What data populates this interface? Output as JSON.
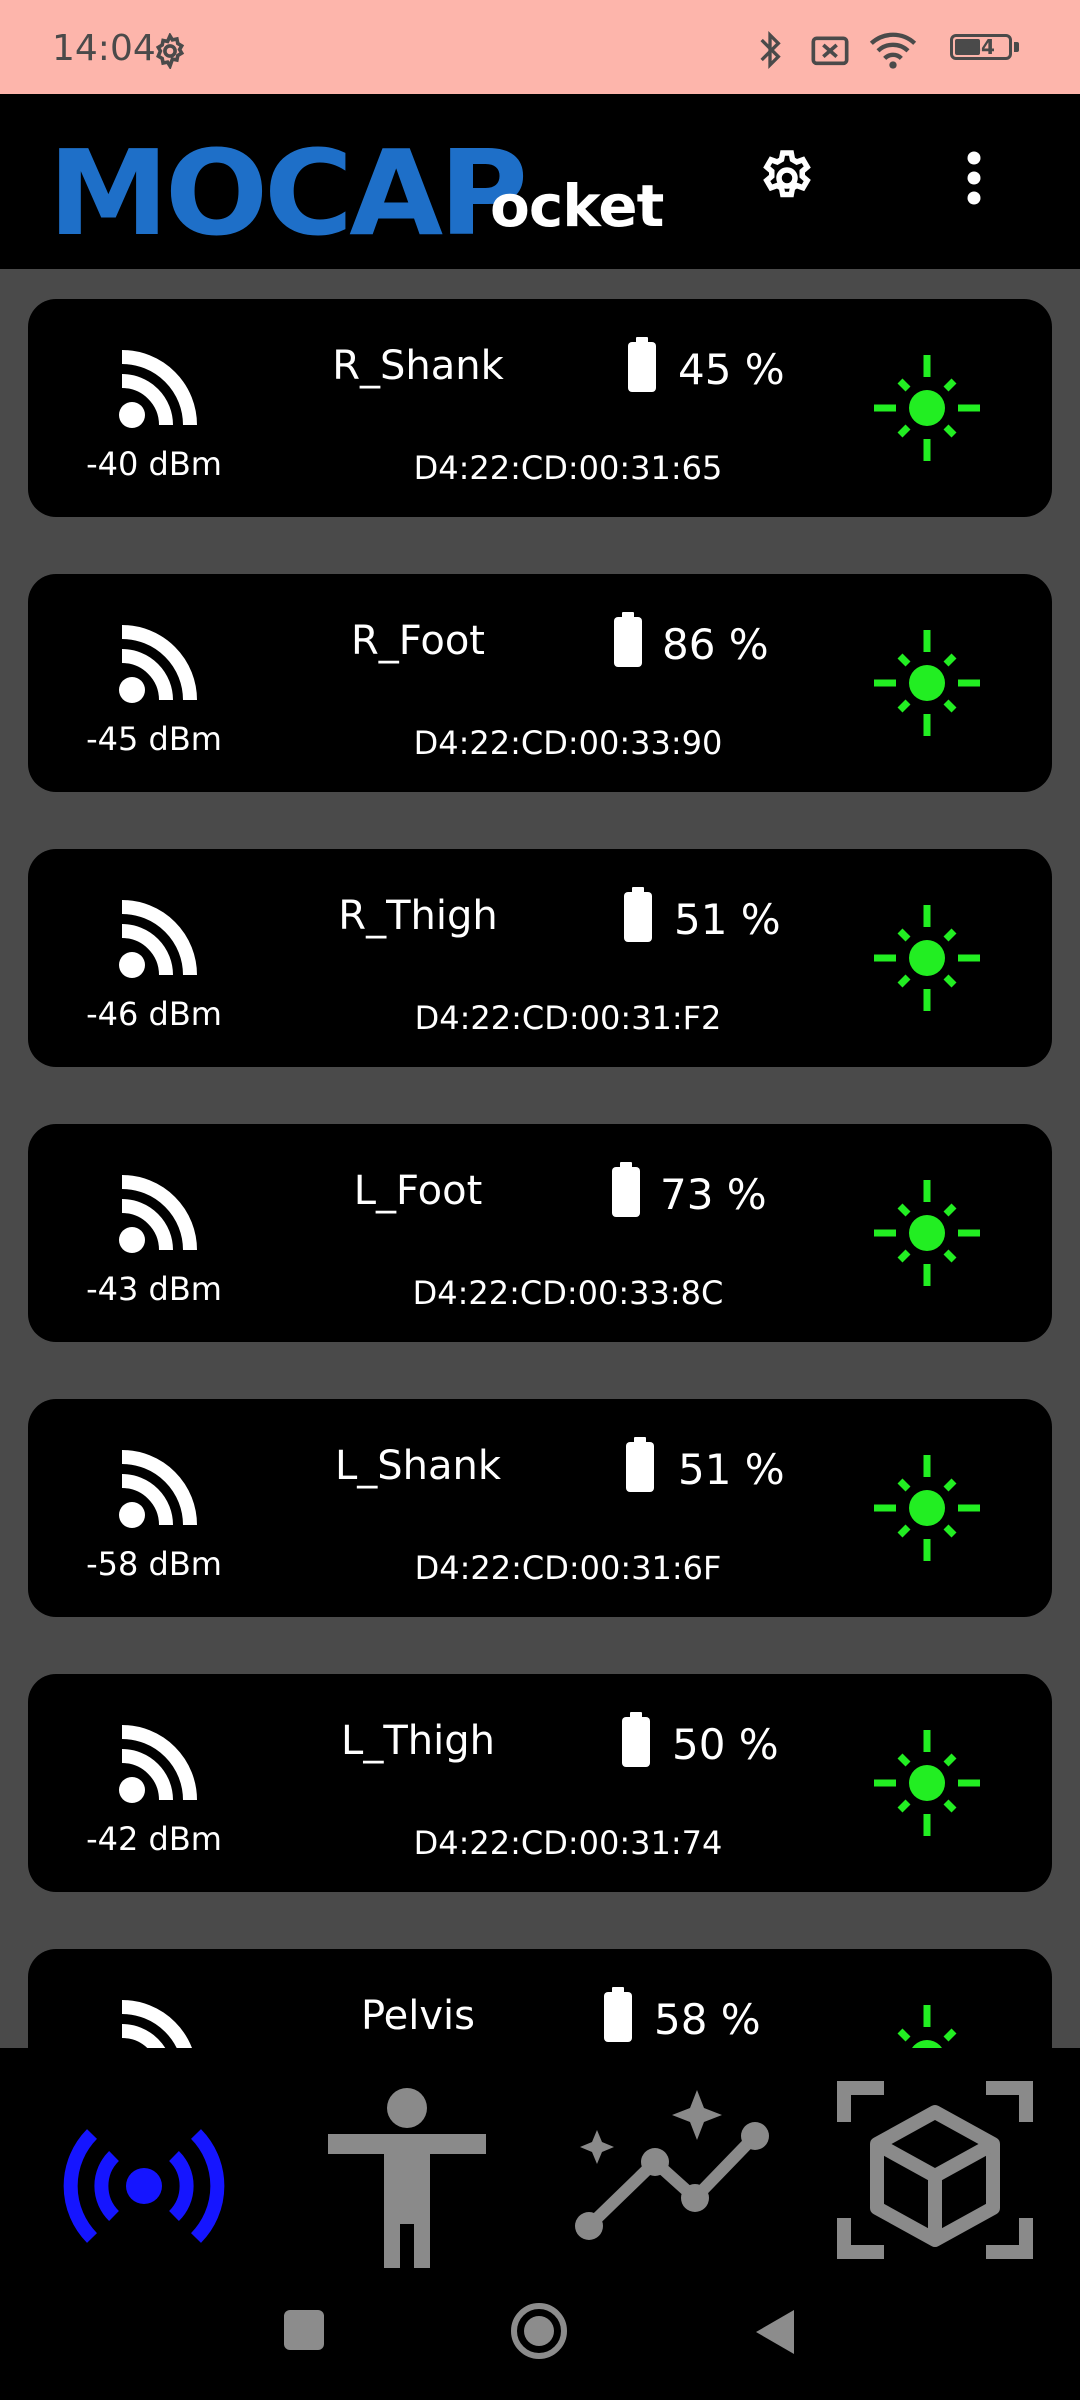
{
  "status_bar": {
    "time": "14:04",
    "battery_level": "44",
    "icons": [
      "settings-gear-icon",
      "bluetooth-icon",
      "screen-record-icon",
      "wifi-icon",
      "battery-icon"
    ]
  },
  "app_bar": {
    "logo_main": "MOCAP",
    "logo_suffix": "ocket",
    "icons": [
      "settings-icon",
      "more-vert-icon"
    ]
  },
  "colors": {
    "status_bar_bg": "#fdb5ab",
    "logo_blue": "#1e6fc8",
    "content_bg": "#4a4a4a",
    "card_bg": "#000000",
    "locate_green": "#22ee22",
    "nav_active_blue": "#1515ff",
    "nav_inactive_gray": "#8a8a8a"
  },
  "sensors": [
    {
      "rssi": "-40 dBm",
      "name": "R_Shank",
      "battery": "45 %",
      "mac": "D4:22:CD:00:31:65"
    },
    {
      "rssi": "-45 dBm",
      "name": "R_Foot",
      "battery": "86 %",
      "mac": "D4:22:CD:00:33:90"
    },
    {
      "rssi": "-46 dBm",
      "name": "R_Thigh",
      "battery": "51 %",
      "mac": "D4:22:CD:00:31:F2"
    },
    {
      "rssi": "-43 dBm",
      "name": "L_Foot",
      "battery": "73 %",
      "mac": "D4:22:CD:00:33:8C"
    },
    {
      "rssi": "-58 dBm",
      "name": "L_Shank",
      "battery": "51 %",
      "mac": "D4:22:CD:00:31:6F"
    },
    {
      "rssi": "-42 dBm",
      "name": "L_Thigh",
      "battery": "50 %",
      "mac": "D4:22:CD:00:31:74"
    },
    {
      "rssi": "",
      "name": "Pelvis",
      "battery": "58 %",
      "mac": ""
    }
  ],
  "bottom_nav": [
    {
      "icon": "sensors-broadcast-icon",
      "active": true
    },
    {
      "icon": "body-pose-icon",
      "active": false
    },
    {
      "icon": "analytics-sparkle-icon",
      "active": false
    },
    {
      "icon": "3d-view-cube-icon",
      "active": false
    }
  ],
  "system_nav": [
    "recents-square-icon",
    "home-circle-icon",
    "back-triangle-icon"
  ]
}
